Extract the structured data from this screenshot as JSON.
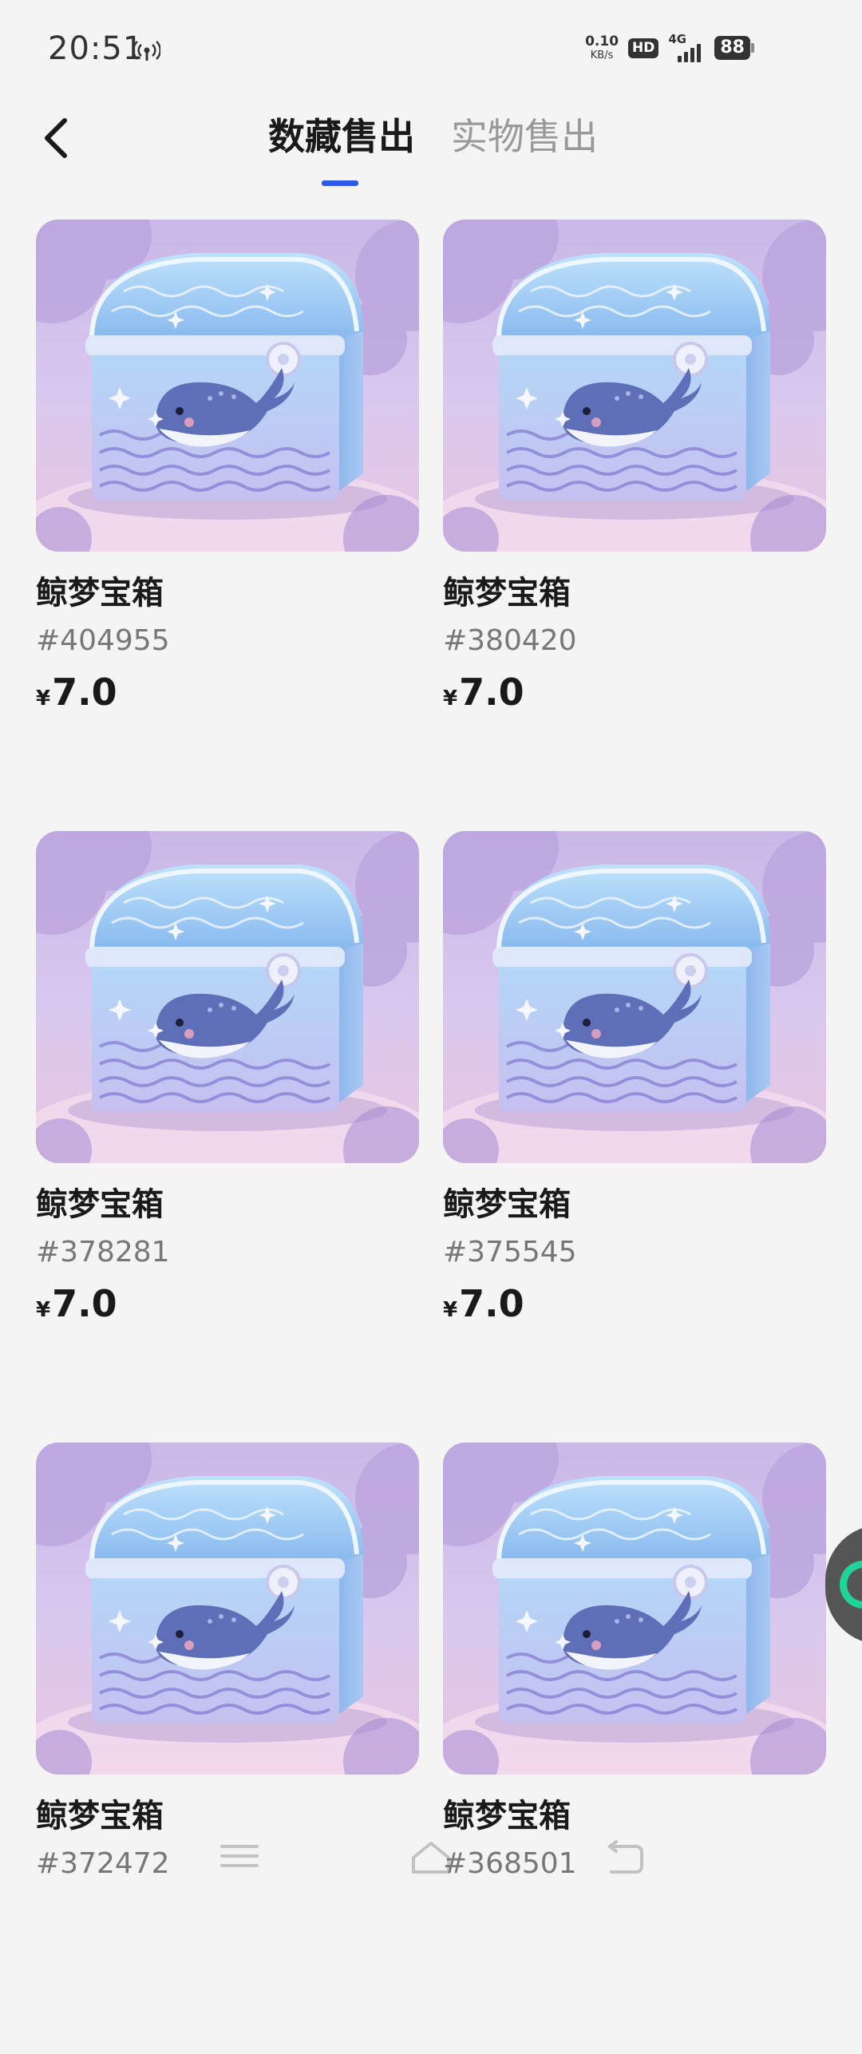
{
  "status_bar": {
    "time": "20:51",
    "net_speed_value": "0.10",
    "net_speed_unit": "KB/s",
    "hd": "HD",
    "network": "4G",
    "battery": "88"
  },
  "header": {
    "tabs": [
      {
        "label": "数藏售出",
        "active": true
      },
      {
        "label": "实物售出",
        "active": false
      }
    ],
    "accent_color": "#2d5be3"
  },
  "items": [
    {
      "name": "鲸梦宝箱",
      "serial": "#404955",
      "currency": "¥",
      "price": "7.0"
    },
    {
      "name": "鲸梦宝箱",
      "serial": "#380420",
      "currency": "¥",
      "price": "7.0"
    },
    {
      "name": "鲸梦宝箱",
      "serial": "#378281",
      "currency": "¥",
      "price": "7.0"
    },
    {
      "name": "鲸梦宝箱",
      "serial": "#375545",
      "currency": "¥",
      "price": "7.0"
    },
    {
      "name": "鲸梦宝箱",
      "serial": "#372472",
      "currency": "¥",
      "price": ""
    },
    {
      "name": "鲸梦宝箱",
      "serial": "#368501",
      "currency": "¥",
      "price": ""
    }
  ]
}
